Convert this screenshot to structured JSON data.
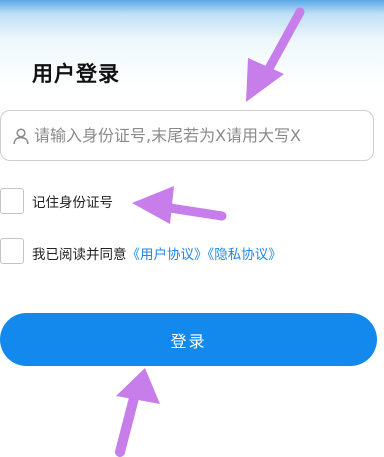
{
  "page": {
    "title": "用户登录"
  },
  "id_input": {
    "value": "",
    "placeholder": "请输入身份证号,末尾若为X请用大写X",
    "icon": "user-icon"
  },
  "remember": {
    "label": "记住身份证号",
    "checked": false
  },
  "agreement": {
    "prefix": "我已阅读并同意",
    "user_agreement": "《用户协议》",
    "privacy_policy": "《隐私协议》",
    "checked": false
  },
  "login_button": {
    "label": "登录"
  },
  "colors": {
    "accent": "#1389ee",
    "link": "#1e88e5",
    "annotation_arrow": "#c77dea"
  }
}
